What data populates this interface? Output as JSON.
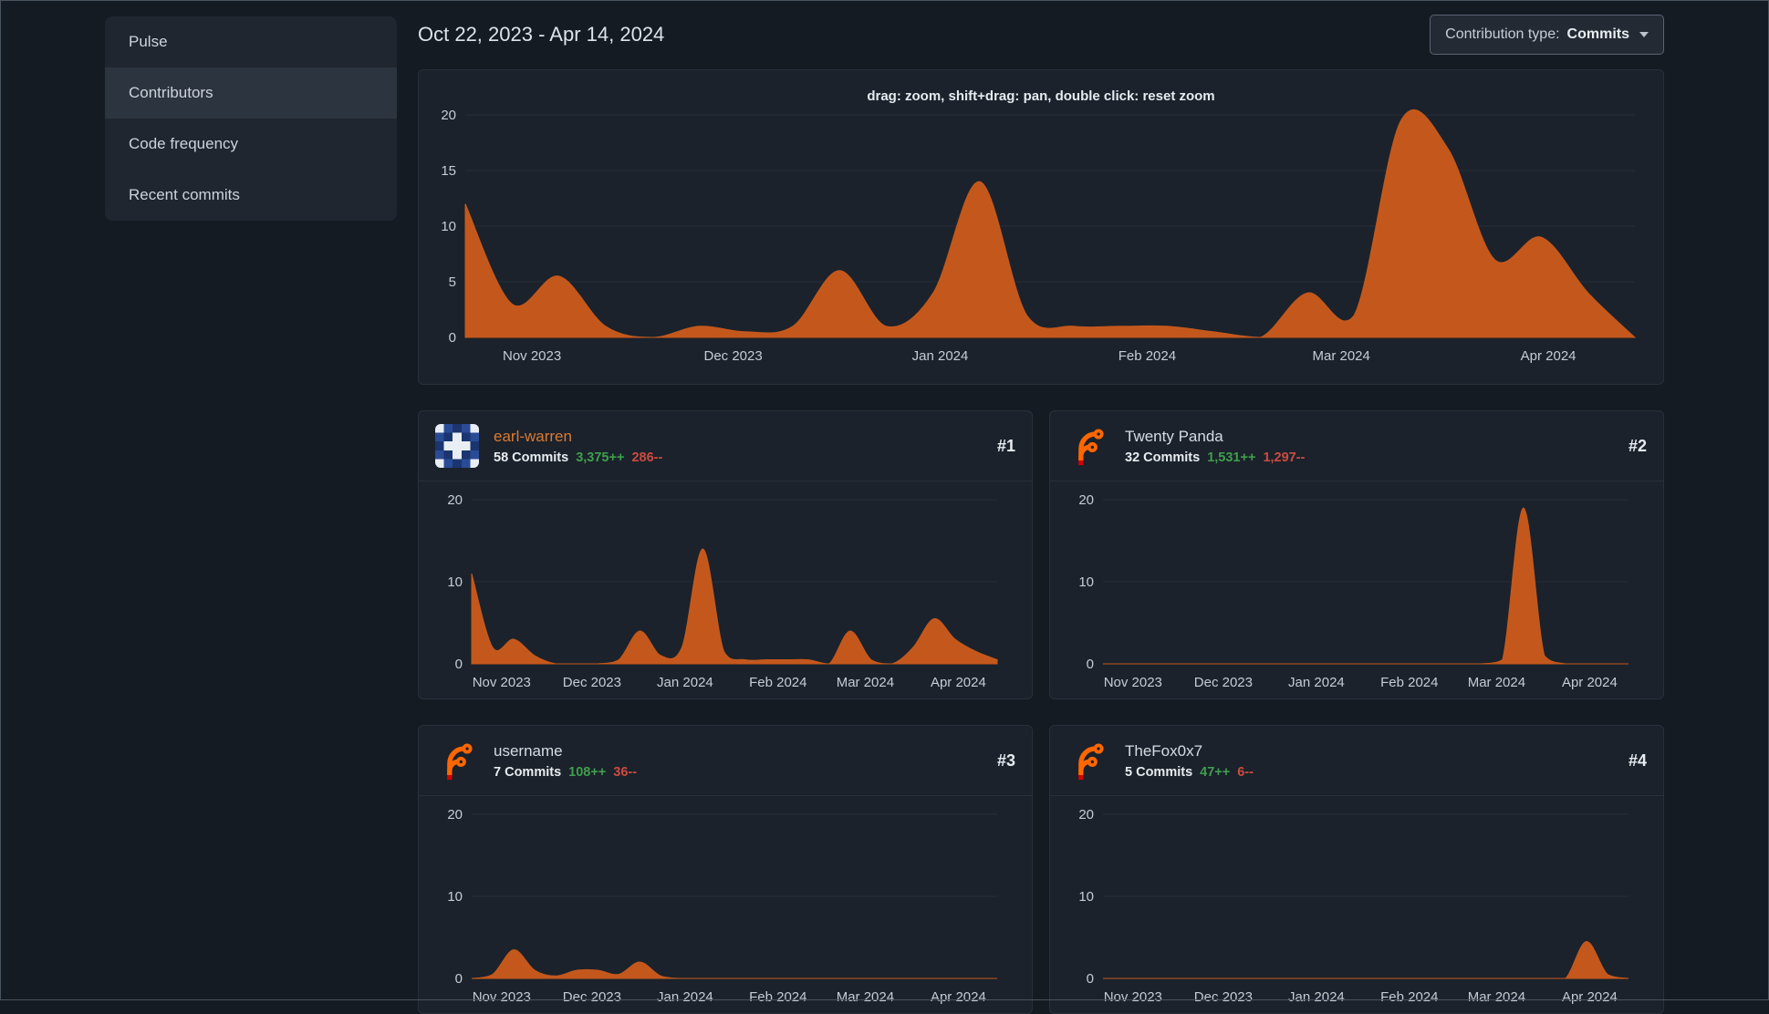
{
  "header": {
    "date_range": "Oct 22, 2023 - Apr 14, 2024",
    "contribution_type_label": "Contribution type:",
    "contribution_type_value": "Commits"
  },
  "sidebar": {
    "items": [
      {
        "label": "Pulse",
        "active": false
      },
      {
        "label": "Contributors",
        "active": true
      },
      {
        "label": "Code frequency",
        "active": false
      },
      {
        "label": "Recent commits",
        "active": false
      }
    ]
  },
  "main_chart_hint": "drag: zoom, shift+drag: pan, double click: reset zoom",
  "contributors": [
    {
      "name": "earl-warren",
      "rank": "#1",
      "commits": "58 Commits",
      "additions": "3,375++",
      "deletions": "286--"
    },
    {
      "name": "Twenty Panda",
      "rank": "#2",
      "commits": "32 Commits",
      "additions": "1,531++",
      "deletions": "1,297--"
    },
    {
      "name": "username",
      "rank": "#3",
      "commits": "7 Commits",
      "additions": "108++",
      "deletions": "36--"
    },
    {
      "name": "TheFox0x7",
      "rank": "#4",
      "commits": "5 Commits",
      "additions": "47++",
      "deletions": "6--"
    }
  ],
  "colors": {
    "area_orange": "#c4581c",
    "additions_green": "#3f9e4d",
    "deletions_red": "#cc4b42",
    "link_orange": "#da7a33"
  },
  "chart_data": [
    {
      "name": "overall-contributions",
      "type": "area",
      "color": "#c4581c",
      "ylim": [
        0,
        20
      ],
      "yticks": [
        0,
        5,
        10,
        15,
        20
      ],
      "x_range": [
        "Oct 22, 2023",
        "Apr 14, 2024"
      ],
      "x_unit": "week",
      "x_ticks": [
        {
          "label": "Nov 2023",
          "f": 0.057
        },
        {
          "label": "Dec 2023",
          "f": 0.229
        },
        {
          "label": "Jan 2024",
          "f": 0.406
        },
        {
          "label": "Feb 2024",
          "f": 0.583
        },
        {
          "label": "Mar 2024",
          "f": 0.749
        },
        {
          "label": "Apr 2024",
          "f": 0.926
        }
      ],
      "values": [
        12,
        3,
        5.5,
        1,
        0,
        1,
        0.5,
        1,
        6,
        1,
        4,
        14,
        2,
        1,
        1,
        1,
        0.5,
        0,
        4,
        2,
        19.5,
        17,
        7,
        9,
        4,
        0
      ]
    },
    {
      "name": "earl-warren-commits",
      "type": "area",
      "color": "#c4581c",
      "ylim": [
        0,
        20
      ],
      "yticks": [
        0,
        10,
        20
      ],
      "x_range": [
        "Oct 22, 2023",
        "Apr 14, 2024"
      ],
      "x_unit": "week",
      "x_ticks": [
        {
          "label": "Nov 2023",
          "f": 0.057
        },
        {
          "label": "Dec 2023",
          "f": 0.229
        },
        {
          "label": "Jan 2024",
          "f": 0.406
        },
        {
          "label": "Feb 2024",
          "f": 0.583
        },
        {
          "label": "Mar 2024",
          "f": 0.749
        },
        {
          "label": "Apr 2024",
          "f": 0.926
        }
      ],
      "values": [
        11,
        2,
        3,
        1,
        0,
        0,
        0,
        0.5,
        4,
        1,
        2,
        14,
        1.5,
        0.5,
        0.5,
        0.5,
        0.5,
        0,
        4,
        0.5,
        0,
        2,
        5.5,
        3,
        1.5,
        0.5
      ]
    },
    {
      "name": "twenty-panda-commits",
      "type": "area",
      "color": "#c4581c",
      "ylim": [
        0,
        20
      ],
      "yticks": [
        0,
        10,
        20
      ],
      "x_range": [
        "Oct 22, 2023",
        "Apr 14, 2024"
      ],
      "x_unit": "week",
      "x_ticks": [
        {
          "label": "Nov 2023",
          "f": 0.057
        },
        {
          "label": "Dec 2023",
          "f": 0.229
        },
        {
          "label": "Jan 2024",
          "f": 0.406
        },
        {
          "label": "Feb 2024",
          "f": 0.583
        },
        {
          "label": "Mar 2024",
          "f": 0.749
        },
        {
          "label": "Apr 2024",
          "f": 0.926
        }
      ],
      "values": [
        0,
        0,
        0,
        0,
        0,
        0,
        0,
        0,
        0,
        0,
        0,
        0,
        0,
        0,
        0,
        0,
        0,
        0,
        0,
        0.5,
        19,
        1,
        0,
        0,
        0,
        0
      ]
    },
    {
      "name": "username-commits",
      "type": "area",
      "color": "#c4581c",
      "ylim": [
        0,
        20
      ],
      "yticks": [
        0,
        10,
        20
      ],
      "x_range": [
        "Oct 22, 2023",
        "Apr 14, 2024"
      ],
      "x_unit": "week",
      "x_ticks": [
        {
          "label": "Nov 2023",
          "f": 0.057
        },
        {
          "label": "Dec 2023",
          "f": 0.229
        },
        {
          "label": "Jan 2024",
          "f": 0.406
        },
        {
          "label": "Feb 2024",
          "f": 0.583
        },
        {
          "label": "Mar 2024",
          "f": 0.749
        },
        {
          "label": "Apr 2024",
          "f": 0.926
        }
      ],
      "values": [
        0,
        0.5,
        3.5,
        1,
        0.3,
        1,
        1,
        0.5,
        2,
        0.3,
        0,
        0,
        0,
        0,
        0,
        0,
        0,
        0,
        0,
        0,
        0,
        0,
        0,
        0,
        0,
        0
      ]
    },
    {
      "name": "thefox0x7-commits",
      "type": "area",
      "color": "#c4581c",
      "ylim": [
        0,
        20
      ],
      "yticks": [
        0,
        10,
        20
      ],
      "x_range": [
        "Oct 22, 2023",
        "Apr 14, 2024"
      ],
      "x_unit": "week",
      "x_ticks": [
        {
          "label": "Nov 2023",
          "f": 0.057
        },
        {
          "label": "Dec 2023",
          "f": 0.229
        },
        {
          "label": "Jan 2024",
          "f": 0.406
        },
        {
          "label": "Feb 2024",
          "f": 0.583
        },
        {
          "label": "Mar 2024",
          "f": 0.749
        },
        {
          "label": "Apr 2024",
          "f": 0.926
        }
      ],
      "values": [
        0,
        0,
        0,
        0,
        0,
        0,
        0,
        0,
        0,
        0,
        0,
        0,
        0,
        0,
        0,
        0,
        0,
        0,
        0,
        0,
        0,
        0,
        0,
        4.5,
        0.5,
        0
      ]
    }
  ]
}
